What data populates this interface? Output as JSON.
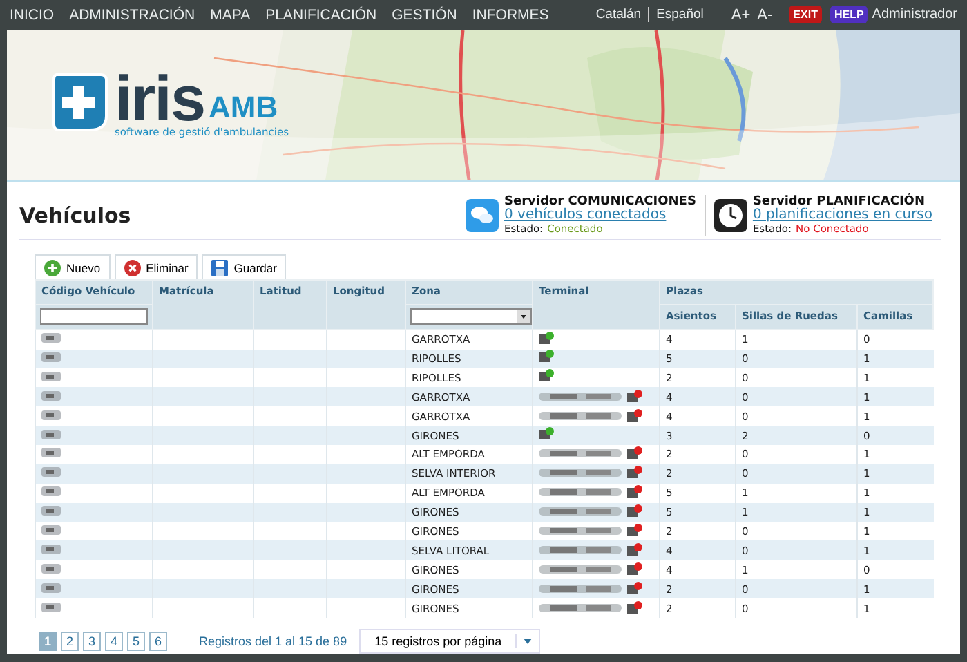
{
  "nav": {
    "items": [
      "INICIO",
      "ADMINISTRACIÓN",
      "MAPA",
      "PLANIFICACIÓN",
      "GESTIÓN",
      "INFORMES"
    ],
    "languages": [
      "Catalán",
      "Español"
    ],
    "font_buttons": [
      "A+",
      "A-"
    ],
    "exit": "EXIT",
    "help": "HELP",
    "user": "Administrador"
  },
  "banner": {
    "logo_main": "iris",
    "logo_sub": "AMB",
    "tagline": "software de gestió d'ambulancies"
  },
  "page_title": "Vehículos",
  "servers": [
    {
      "kind": "chat",
      "title": "Servidor COMUNICACIONES",
      "link": "0 vehículos conectados",
      "status_label": "Estado:",
      "status": "Conectado",
      "connected": true
    },
    {
      "kind": "clock",
      "title": "Servidor PLANIFICACIÓN",
      "link": "0 planificaciones en curso",
      "status_label": "Estado:",
      "status": "No Conectado",
      "connected": false
    }
  ],
  "toolbar": [
    {
      "kind": "add",
      "label": "Nuevo"
    },
    {
      "kind": "delete",
      "label": "Eliminar"
    },
    {
      "kind": "save",
      "label": "Guardar"
    }
  ],
  "table": {
    "columns": [
      "Código Vehículo",
      "Matrícula",
      "Latitud",
      "Longitud",
      "Zona",
      "Terminal"
    ],
    "group": "Plazas",
    "subcolumns": [
      "Asientos",
      "Sillas de Ruedas",
      "Camillas"
    ],
    "rows": [
      {
        "zone": "GARROTXA",
        "terminal_connected": true,
        "seats": "4",
        "wheelchairs": "1",
        "stretchers": "0"
      },
      {
        "zone": "RIPOLLES",
        "terminal_connected": true,
        "seats": "5",
        "wheelchairs": "0",
        "stretchers": "1"
      },
      {
        "zone": "RIPOLLES",
        "terminal_connected": true,
        "seats": "2",
        "wheelchairs": "0",
        "stretchers": "1"
      },
      {
        "zone": "GARROTXA",
        "terminal_connected": false,
        "seats": "4",
        "wheelchairs": "0",
        "stretchers": "1"
      },
      {
        "zone": "GARROTXA",
        "terminal_connected": false,
        "seats": "4",
        "wheelchairs": "0",
        "stretchers": "1"
      },
      {
        "zone": "GIRONES",
        "terminal_connected": true,
        "seats": "3",
        "wheelchairs": "2",
        "stretchers": "0"
      },
      {
        "zone": "ALT EMPORDA",
        "terminal_connected": false,
        "seats": "2",
        "wheelchairs": "0",
        "stretchers": "1"
      },
      {
        "zone": "SELVA INTERIOR",
        "terminal_connected": false,
        "seats": "2",
        "wheelchairs": "0",
        "stretchers": "1"
      },
      {
        "zone": "ALT EMPORDA",
        "terminal_connected": false,
        "seats": "5",
        "wheelchairs": "1",
        "stretchers": "1"
      },
      {
        "zone": "GIRONES",
        "terminal_connected": false,
        "seats": "5",
        "wheelchairs": "1",
        "stretchers": "1"
      },
      {
        "zone": "GIRONES",
        "terminal_connected": false,
        "seats": "2",
        "wheelchairs": "0",
        "stretchers": "1"
      },
      {
        "zone": "SELVA LITORAL",
        "terminal_connected": false,
        "seats": "4",
        "wheelchairs": "0",
        "stretchers": "1"
      },
      {
        "zone": "GIRONES",
        "terminal_connected": false,
        "seats": "4",
        "wheelchairs": "1",
        "stretchers": "0"
      },
      {
        "zone": "GIRONES",
        "terminal_connected": false,
        "seats": "2",
        "wheelchairs": "0",
        "stretchers": "1"
      },
      {
        "zone": "GIRONES",
        "terminal_connected": false,
        "seats": "2",
        "wheelchairs": "0",
        "stretchers": "1"
      }
    ]
  },
  "pagination": {
    "pages": [
      {
        "label": "1",
        "selected": true
      },
      {
        "label": "2",
        "selected": false
      },
      {
        "label": "3",
        "selected": false
      },
      {
        "label": "4",
        "selected": false
      },
      {
        "label": "5",
        "selected": false
      },
      {
        "label": "6",
        "selected": false
      }
    ],
    "info": "Registros del 1 al 15 de 89",
    "per_page": "15 registros por página"
  }
}
